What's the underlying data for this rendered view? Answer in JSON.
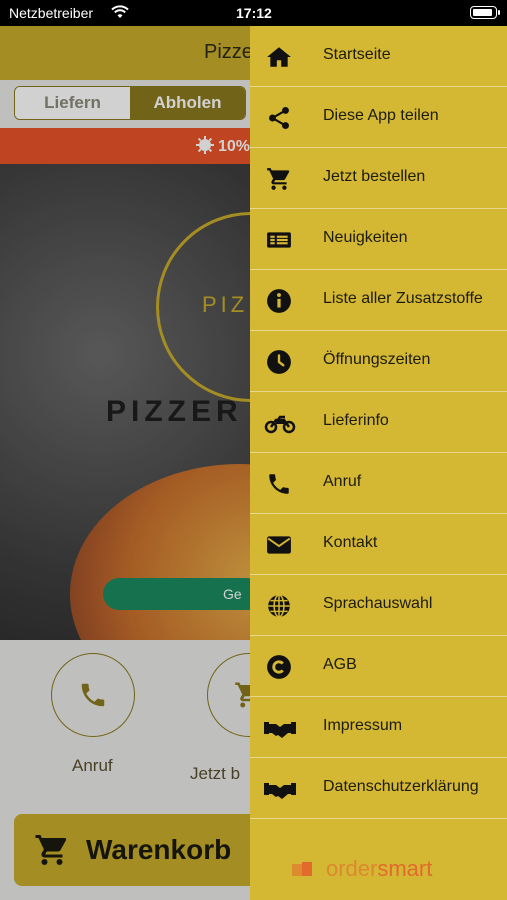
{
  "status_bar": {
    "carrier": "Netzbetreiber",
    "time": "17:12"
  },
  "header": {
    "title": "Pizze"
  },
  "segment": {
    "deliver": "Liefern",
    "pickup": "Abholen"
  },
  "promo": {
    "text": "10%"
  },
  "hero": {
    "logo_small": "PIZ",
    "logo_word": "PIZZER",
    "pill_text": "Ge"
  },
  "actions": {
    "call_label": "Anruf",
    "order_label": "Jetzt b"
  },
  "cart": {
    "label": "Warenkorb"
  },
  "drawer": {
    "items": [
      {
        "label": "Startseite",
        "icon": "home-icon"
      },
      {
        "label": "Diese App teilen",
        "icon": "share-icon"
      },
      {
        "label": "Jetzt bestellen",
        "icon": "cart-icon"
      },
      {
        "label": "Neuigkeiten",
        "icon": "news-icon"
      },
      {
        "label": "Liste aller Zusatzstoffe",
        "icon": "info-icon"
      },
      {
        "label": "Öffnungszeiten",
        "icon": "clock-icon"
      },
      {
        "label": "Lieferinfo",
        "icon": "motorbike-icon"
      },
      {
        "label": "Anruf",
        "icon": "phone-icon"
      },
      {
        "label": "Kontakt",
        "icon": "mail-icon"
      },
      {
        "label": "Sprachauswahl",
        "icon": "globe-icon"
      },
      {
        "label": "AGB",
        "icon": "copyright-icon"
      },
      {
        "label": "Impressum",
        "icon": "handshake-icon"
      },
      {
        "label": "Datenschutzerklärung",
        "icon": "handshake-icon"
      }
    ],
    "brand": {
      "part1": "order",
      "part2": "smart"
    }
  },
  "colors": {
    "accent": "#c8ad2a",
    "drawer": "#d4b732",
    "promo": "#e8532a",
    "brand": "#e26a2c"
  }
}
